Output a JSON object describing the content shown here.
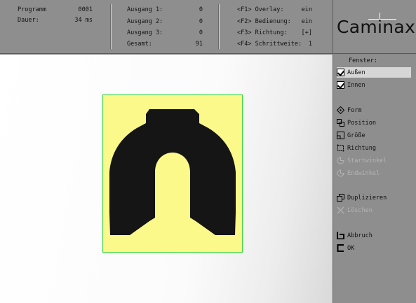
{
  "header": {
    "col1": [
      {
        "label": "Programm",
        "value": "0001"
      },
      {
        "label": "Dauer:",
        "value": "34 ms"
      }
    ],
    "col2": [
      {
        "label": "Ausgang 1:",
        "value": "0"
      },
      {
        "label": "Ausgang 2:",
        "value": "0"
      },
      {
        "label": "Ausgang 3:",
        "value": "0"
      },
      {
        "label": "Gesamt:",
        "value": "91"
      }
    ],
    "col3": [
      {
        "label": "<F1> Overlay:",
        "value": "ein"
      },
      {
        "label": "<F2> Bedienung:",
        "value": "ein"
      },
      {
        "label": "<F3> Richtung:",
        "value": "[+]"
      },
      {
        "label": "<F4> Schrittweite:",
        "value": "1"
      }
    ]
  },
  "logo": {
    "text": "Caminax"
  },
  "side": {
    "title": "Fenster:",
    "items": [
      {
        "label": "Außen",
        "icon": "checkbox-checked-icon",
        "selected": true,
        "enabled": true
      },
      {
        "label": "Innen",
        "icon": "checkbox-checked-icon",
        "selected": false,
        "enabled": true
      },
      {
        "label": "Form",
        "icon": "diamond-icon",
        "selected": false,
        "enabled": true
      },
      {
        "label": "Position",
        "icon": "position-icon",
        "selected": false,
        "enabled": true
      },
      {
        "label": "Größe",
        "icon": "size-icon",
        "selected": false,
        "enabled": true
      },
      {
        "label": "Richtung",
        "icon": "direction-icon",
        "selected": false,
        "enabled": true
      },
      {
        "label": "Startwinkel",
        "icon": "start-angle-icon",
        "selected": false,
        "enabled": false
      },
      {
        "label": "Endwinkel",
        "icon": "end-angle-icon",
        "selected": false,
        "enabled": false
      },
      {
        "label": "Duplizieren",
        "icon": "duplicate-icon",
        "selected": false,
        "enabled": true
      },
      {
        "label": "Löschen",
        "icon": "delete-icon",
        "selected": false,
        "enabled": false
      },
      {
        "label": "Abbruch",
        "icon": "cancel-icon",
        "selected": false,
        "enabled": true
      },
      {
        "label": "OK",
        "icon": "ok-icon",
        "selected": false,
        "enabled": true
      }
    ]
  },
  "colors": {
    "roi_fill": "#fbf98a",
    "roi_border": "#37d937",
    "shape": "#151515",
    "panel": "#8e8e8e"
  }
}
